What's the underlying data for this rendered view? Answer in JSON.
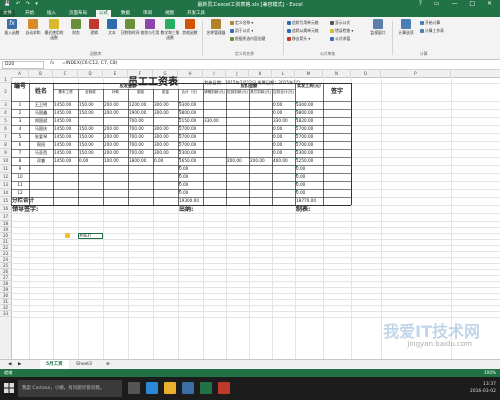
{
  "window": {
    "title": "最新员工excel工资表格.xls  [兼容模式] - Excel",
    "controls": [
      "?",
      "▭",
      "—",
      "□",
      "✕"
    ],
    "quick_access": [
      "💾",
      "↶",
      "↷",
      "▾"
    ]
  },
  "ribbon_tabs": [
    "文件",
    "开始",
    "插入",
    "页面布局",
    "公式",
    "数据",
    "审阅",
    "视图",
    "开发工具"
  ],
  "active_tab": "公式",
  "ribbon": {
    "buttons": [
      {
        "label": "插入函数",
        "icon": "fx-icon",
        "color": "#3a6ea5"
      },
      {
        "label": "自动求和",
        "icon": "sum-icon",
        "color": "#d98a2b"
      },
      {
        "label": "最近使用的函数",
        "icon": "star-icon",
        "color": "#d9b82b"
      },
      {
        "label": "财务",
        "icon": "book-icon",
        "color": "#6a8f3a"
      },
      {
        "label": "逻辑",
        "icon": "book-icon",
        "color": "#6a8f3a"
      },
      {
        "label": "文本",
        "icon": "book-icon",
        "color": "#6a8f3a"
      },
      {
        "label": "日期和时间",
        "icon": "book-icon",
        "color": "#6a8f3a"
      },
      {
        "label": "查找与引用",
        "icon": "book-icon",
        "color": "#6a8f3a"
      },
      {
        "label": "数学和三角函数",
        "icon": "book-icon",
        "color": "#6a8f3a"
      },
      {
        "label": "其他函数",
        "icon": "book-icon",
        "color": "#6a8f3a"
      },
      {
        "label": "名称管理器",
        "icon": "tag-icon",
        "color": "#b0822b"
      }
    ],
    "name_group": [
      "定义名称 ▾",
      "用于公式 ▾",
      "根据所选内容创建"
    ],
    "audit_group": [
      "追踪引用单元格",
      "追踪从属单元格",
      "移去箭头 ▾",
      "显示公式",
      "错误检查 ▾",
      "公式求值"
    ],
    "watch_button": "监视窗口",
    "calc_buttons": [
      "计算选项",
      "开始计算",
      "计算工作表"
    ],
    "group_labels": [
      "函数库",
      "定义的名称",
      "公式审核",
      "计算"
    ]
  },
  "formula_bar": {
    "name_box": "D20",
    "fx": "fx",
    "formula": "=INDEX(C6:C12, C7, C8)"
  },
  "columns": [
    "A",
    "B",
    "C",
    "D",
    "E",
    "F",
    "G",
    "H",
    "I",
    "J",
    "K",
    "L",
    "M",
    "N",
    "O",
    "P"
  ],
  "rows": [
    "1",
    "2",
    "3",
    "4",
    "5",
    "6",
    "7",
    "8",
    "9",
    "10",
    "11",
    "12",
    "13",
    "14",
    "15",
    "16",
    "17",
    "18",
    "19",
    "20",
    "21",
    "22",
    "23",
    "24",
    "25",
    "26",
    "27",
    "28",
    "29",
    "30",
    "31",
    "32",
    "33"
  ],
  "sheet": {
    "title": "员工工资表",
    "issue_date": "发放日期：2015年2月12日 所属日期：2015年1月",
    "headers": {
      "num": "编号",
      "name": "姓名",
      "payable_group": "应发金额",
      "deduct_group": "应扣金额",
      "actual": "实发工资(元)",
      "sign": "签字",
      "sub": [
        "基本工资",
        "全勤奖",
        "补助",
        "奖励",
        "奖金",
        "合计（元）",
        "请假扣款(元)",
        "迟到扣款(元)",
        "其它扣款(元)",
        "应扣合计(元)"
      ]
    },
    "rows": [
      {
        "no": "1",
        "name": "王卫明",
        "v": [
          "1450.00",
          "150.00",
          "200.00",
          "1200.00",
          "300.00",
          "3300.00",
          "",
          "",
          "",
          "0.00",
          "3300.00"
        ]
      },
      {
        "no": "2",
        "name": "马国鑫",
        "v": [
          "1450.00",
          "150.00",
          "200.00",
          "1900.00",
          "300.00",
          "3800.00",
          "",
          "",
          "",
          "0.00",
          "3800.00"
        ]
      },
      {
        "no": "3",
        "name": "郑国斌",
        "v": [
          "1450.00",
          "",
          "",
          "700.00",
          "",
          "2150.00",
          "330.00",
          "",
          "",
          "330.00",
          "1820.00"
        ]
      },
      {
        "no": "4",
        "name": "马国庆",
        "v": [
          "1450.00",
          "150.00",
          "200.00",
          "700.00",
          "300.00",
          "2700.00",
          "",
          "",
          "",
          "0.00",
          "2700.00"
        ]
      },
      {
        "no": "5",
        "name": "张爱琴",
        "v": [
          "1450.00",
          "150.00",
          "200.00",
          "700.00",
          "300.00",
          "2700.00",
          "",
          "",
          "",
          "0.00",
          "2700.00"
        ]
      },
      {
        "no": "6",
        "name": "周阳",
        "v": [
          "1450.00",
          "150.00",
          "200.00",
          "700.00",
          "300.00",
          "2700.00",
          "",
          "",
          "",
          "0.00",
          "2700.00"
        ]
      },
      {
        "no": "7",
        "name": "马亚西",
        "v": [
          "1450.00",
          "150.00",
          "200.00",
          "700.00",
          "300.00",
          "2300.00",
          "",
          "",
          "",
          "0.00",
          "2300.00"
        ]
      },
      {
        "no": "8",
        "name": "邓睿",
        "v": [
          "1450.00",
          "0.00",
          "100.00",
          "1800.00",
          "0.00",
          "1650.00",
          "",
          "200.00",
          "200.00",
          "400.00",
          "1250.00"
        ]
      },
      {
        "no": "9",
        "name": "",
        "v": [
          "",
          "",
          "",
          "",
          "",
          "0.00",
          "",
          "",
          "",
          "",
          "0.00"
        ]
      },
      {
        "no": "10",
        "name": "",
        "v": [
          "",
          "",
          "",
          "",
          "",
          "0.00",
          "",
          "",
          "",
          "",
          "0.00"
        ]
      },
      {
        "no": "11",
        "name": "",
        "v": [
          "",
          "",
          "",
          "",
          "",
          "0.00",
          "",
          "",
          "",
          "",
          "0.00"
        ]
      },
      {
        "no": "12",
        "name": "",
        "v": [
          "",
          "",
          "",
          "",
          "",
          "0.00",
          "",
          "",
          "",
          "",
          "0.00"
        ]
      }
    ],
    "subtotal_label": "分栏合计",
    "subtotal_total": "19300.00",
    "subtotal_actual": "18770.00",
    "footer": {
      "leader": "领导签字:",
      "cashier": "出纳:",
      "maker": "制表:"
    },
    "selected_cell_text": "#REF!"
  },
  "sheet_tabs": [
    "5月工资",
    "Sheet3"
  ],
  "active_sheet": "5月工资",
  "status": {
    "left": "就绪",
    "zoom": "100%"
  },
  "taskbar": {
    "search_placeholder": "我是 Cortana，小娜。有问题尽管问我。",
    "time": "13:37",
    "date": "2016-03-02"
  },
  "watermark": {
    "text": "我爱IT技术网",
    "url": "jingyan.baidu.com"
  }
}
